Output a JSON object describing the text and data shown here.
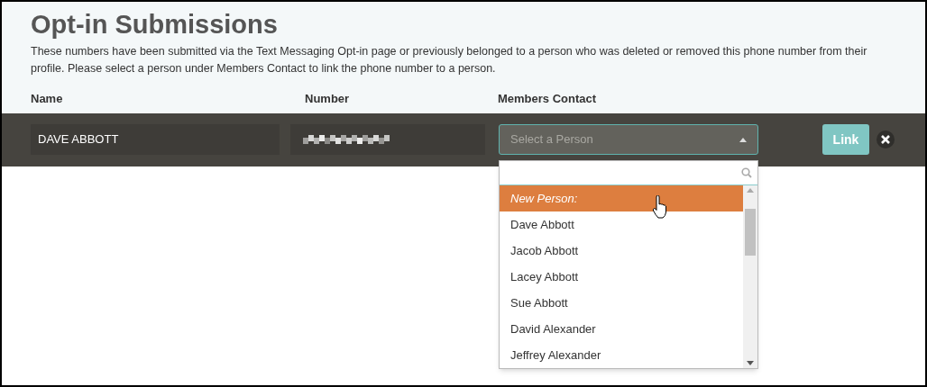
{
  "title": "Opt-in Submissions",
  "description": "These numbers have been submitted via the Text Messaging Opt-in page or previously belonged to a person who was deleted or removed this phone number from their profile. Please select a person under Members Contact to link the phone number to a person.",
  "columns": [
    "Name",
    "Number",
    "Members Contact"
  ],
  "row": {
    "name": "DAVE ABBOTT",
    "select": {
      "placeholder": "Select a Person",
      "expanded": true
    },
    "link_button": "Link"
  },
  "options": [
    {
      "label": "New Person:",
      "kind": "new",
      "selected": true
    },
    {
      "label": "Dave Abbott",
      "kind": "person",
      "selected": false
    },
    {
      "label": "Jacob Abbott",
      "kind": "person",
      "selected": false
    },
    {
      "label": "Lacey Abbott",
      "kind": "person",
      "selected": false
    },
    {
      "label": "Sue Abbott",
      "kind": "person",
      "selected": false
    },
    {
      "label": "David Alexander",
      "kind": "person",
      "selected": false
    },
    {
      "label": "Jeffrey Alexander",
      "kind": "person",
      "selected": false
    }
  ]
}
